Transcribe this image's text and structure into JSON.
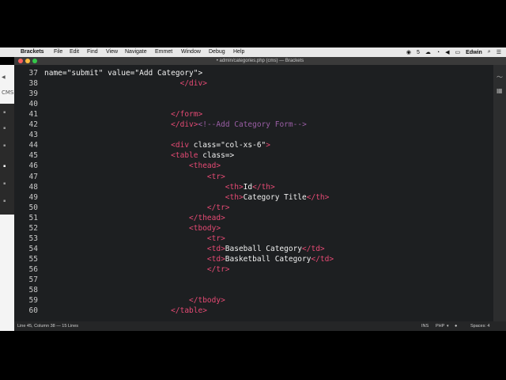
{
  "menubar": {
    "app": "Brackets",
    "items": [
      "File",
      "Edit",
      "Find",
      "View",
      "Navigate",
      "Emmet",
      "Window",
      "Debug",
      "Help"
    ],
    "status_num": "5",
    "user": "Edwin"
  },
  "window": {
    "title": "• admin/categories.php (cms) — Brackets"
  },
  "background": {
    "title_fragment": "CMS"
  },
  "editor": {
    "lines": [
      {
        "n": "37",
        "parts": [
          [
            "txt",
            "name=\"submit\" value=\"Add Category\">"
          ]
        ]
      },
      {
        "n": "38",
        "parts": [
          [
            "txt",
            "                              "
          ],
          [
            "tag",
            "</"
          ],
          [
            "tag",
            "div"
          ],
          [
            "tag",
            ">"
          ]
        ]
      },
      {
        "n": "39",
        "parts": []
      },
      {
        "n": "40",
        "parts": []
      },
      {
        "n": "41",
        "parts": [
          [
            "txt",
            "                            "
          ],
          [
            "tag",
            "</"
          ],
          [
            "tag",
            "form"
          ],
          [
            "tag",
            ">"
          ]
        ]
      },
      {
        "n": "42",
        "parts": [
          [
            "txt",
            "                            "
          ],
          [
            "tag",
            "</"
          ],
          [
            "tag",
            "div"
          ],
          [
            "tag",
            ">"
          ],
          [
            "cmt",
            "<!--Add Category Form-->"
          ]
        ]
      },
      {
        "n": "43",
        "parts": []
      },
      {
        "n": "44",
        "parts": [
          [
            "txt",
            "                            "
          ],
          [
            "tag",
            "<div "
          ],
          [
            "txt",
            "class=\"col-xs-6\""
          ],
          [
            "tag",
            ">"
          ]
        ]
      },
      {
        "n": "45",
        "parts": [
          [
            "txt",
            "                            "
          ],
          [
            "tag",
            "<table "
          ],
          [
            "txt",
            "class=>"
          ]
        ]
      },
      {
        "n": "46",
        "parts": [
          [
            "txt",
            "                                "
          ],
          [
            "tag",
            "<thead>"
          ]
        ]
      },
      {
        "n": "47",
        "parts": [
          [
            "txt",
            "                                    "
          ],
          [
            "tag",
            "<tr>"
          ]
        ]
      },
      {
        "n": "48",
        "parts": [
          [
            "txt",
            "                                        "
          ],
          [
            "tag",
            "<th>"
          ],
          [
            "txt",
            "Id"
          ],
          [
            "tag",
            "</th>"
          ]
        ]
      },
      {
        "n": "49",
        "parts": [
          [
            "txt",
            "                                        "
          ],
          [
            "tag",
            "<th>"
          ],
          [
            "txt",
            "Category Title"
          ],
          [
            "tag",
            "</th>"
          ]
        ]
      },
      {
        "n": "50",
        "parts": [
          [
            "txt",
            "                                    "
          ],
          [
            "tag",
            "</tr>"
          ]
        ]
      },
      {
        "n": "51",
        "parts": [
          [
            "txt",
            "                                "
          ],
          [
            "tag",
            "</thead>"
          ]
        ]
      },
      {
        "n": "52",
        "parts": [
          [
            "txt",
            "                                "
          ],
          [
            "tag",
            "<tbody>"
          ]
        ]
      },
      {
        "n": "53",
        "parts": [
          [
            "txt",
            "                                    "
          ],
          [
            "tag",
            "<tr>"
          ]
        ]
      },
      {
        "n": "54",
        "parts": [
          [
            "txt",
            "                                    "
          ],
          [
            "tag",
            "<td>"
          ],
          [
            "txt",
            "Baseball Category"
          ],
          [
            "tag",
            "</td>"
          ]
        ]
      },
      {
        "n": "55",
        "parts": [
          [
            "txt",
            "                                    "
          ],
          [
            "tag",
            "<td>"
          ],
          [
            "txt",
            "Basketball Category"
          ],
          [
            "tag",
            "</td>"
          ]
        ]
      },
      {
        "n": "56",
        "parts": [
          [
            "txt",
            "                                    "
          ],
          [
            "tag",
            "</tr>"
          ]
        ]
      },
      {
        "n": "57",
        "parts": []
      },
      {
        "n": "58",
        "parts": []
      },
      {
        "n": "59",
        "parts": [
          [
            "txt",
            "                                "
          ],
          [
            "tag",
            "</tbody>"
          ]
        ]
      },
      {
        "n": "60",
        "parts": [
          [
            "txt",
            "                            "
          ],
          [
            "tag",
            "</table>"
          ]
        ]
      }
    ]
  },
  "statusbar": {
    "cursor": "Line 45, Column 38 — 15 Lines",
    "mode": "INS",
    "language": "PHP",
    "spaces": "Spaces: 4"
  }
}
